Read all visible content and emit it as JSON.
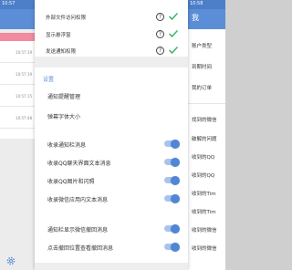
{
  "left_screen": {
    "status_time": "10:57",
    "rows": [
      {
        "time": "10:57:19"
      },
      {
        "time": "10:57:19"
      },
      {
        "time": "10:57:15"
      },
      {
        "time": "10:57:48"
      }
    ]
  },
  "right_screen": {
    "status_time": "10:58",
    "title": "我",
    "items": [
      "账户类型",
      "到期时间",
      "我的订单",
      "找到的微信",
      "破解的问题",
      "收到的QQ",
      "收到的QQ",
      "收到的Tim",
      "收到的Tim",
      "收到的微信",
      "收到的微信"
    ]
  },
  "permissions": [
    {
      "label": "外部文件访问权限"
    },
    {
      "label": "显示悬浮窗"
    },
    {
      "label": "发送通知权限"
    }
  ],
  "settings": {
    "section_title": "设置",
    "links": [
      "通知提醒管理",
      "弹幕字体大小"
    ],
    "toggles": [
      {
        "label": "收录通知栏消息",
        "on": true
      },
      {
        "label": "收录QQ聊天界面文本消息",
        "on": true
      },
      {
        "label": "收录QQ图片和闪照",
        "on": true
      },
      {
        "label": "收录微信应用内文本消息",
        "on": true
      },
      {
        "label": "通知栏显示微信撤回消息",
        "on": true
      },
      {
        "label": "点击撤回位置查看撤回消息",
        "on": true
      }
    ]
  },
  "colors": {
    "accent": "#5b8ed6",
    "check": "#3cb371",
    "toggle_on": "#4f86d8"
  }
}
